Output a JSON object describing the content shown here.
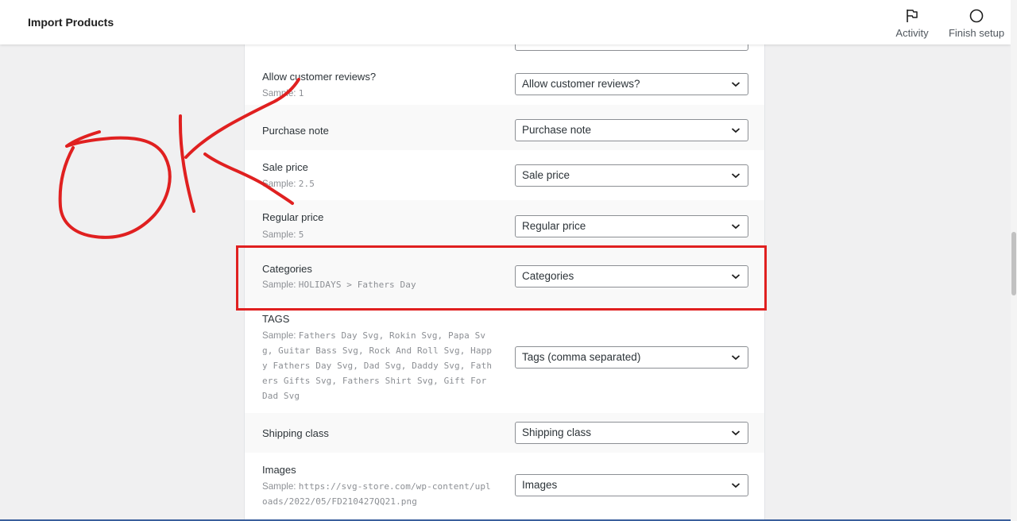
{
  "header": {
    "title": "Import Products",
    "activity_label": "Activity",
    "finish_label": "Finish setup"
  },
  "fields": [
    {
      "label": "Allow customer reviews?",
      "sample_prefix": "Sample:",
      "sample": "1",
      "select": "Allow customer reviews?"
    },
    {
      "label": "Purchase note",
      "select": "Purchase note"
    },
    {
      "label": "Sale price",
      "sample_prefix": "Sample:",
      "sample": "2.5",
      "select": "Sale price"
    },
    {
      "label": "Regular price",
      "sample_prefix": "Sample:",
      "sample": "5",
      "select": "Regular price"
    },
    {
      "label": "Categories",
      "sample_prefix": "Sample:",
      "sample": "HOLIDAYS > Fathers Day",
      "select": "Categories"
    },
    {
      "label": "TAGS",
      "sample_prefix": "Sample:",
      "sample": "Fathers Day Svg, Rokin Svg, Papa Svg, Guitar Bass Svg, Rock And Roll Svg, Happy Fathers Day Svg, Dad Svg, Daddy Svg, Fathers Gifts Svg, Fathers Shirt Svg, Gift For Dad Svg",
      "select": "Tags (comma separated)"
    },
    {
      "label": "Shipping class",
      "select": "Shipping class"
    },
    {
      "label": "Images",
      "sample_prefix": "Sample:",
      "sample": "https://svg-store.com/wp-content/uploads/2022/05/FD210427QQ21.png",
      "select": "Images"
    }
  ],
  "colors": {
    "annotation": "#e02020",
    "accent_line": "#3a5f9c"
  },
  "icons": {
    "activity": "flag-icon",
    "finish_setup": "circle-icon",
    "select_arrow": "chevron-down-icon"
  }
}
